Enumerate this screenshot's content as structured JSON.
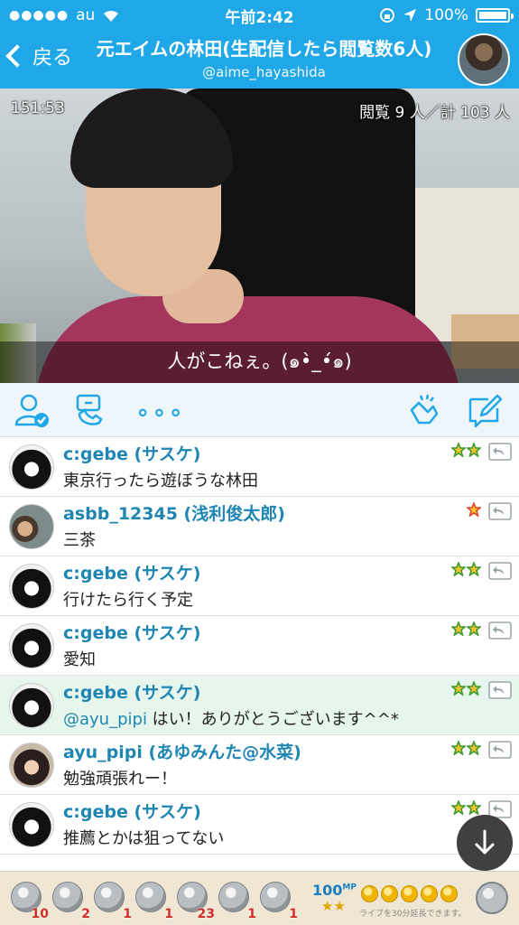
{
  "status_bar": {
    "signal": "●●●●●",
    "carrier": "au",
    "time": "午前2:42",
    "battery": "100%"
  },
  "nav": {
    "back_label": "戻る",
    "title": "元エイムの林田(生配信したら閲覧数6人)",
    "subtitle": "@aime_hayashida"
  },
  "video": {
    "elapsed": "151:53",
    "views": "閲覧 9 人／計 103 人",
    "caption": "人がこねぇ。(๑•̀_•́๑)"
  },
  "toolbar": {
    "more_label": "∘∘∘"
  },
  "comments": [
    {
      "name": "c:gebe (サスケ)",
      "message": "東京行ったら遊ぼうな林田",
      "avatar": "gebe",
      "badge": "green-double",
      "highlight": false
    },
    {
      "name": "asbb_12345 (浅利俊太郎)",
      "message": "三茶",
      "avatar": "asbb",
      "badge": "red-single",
      "highlight": false
    },
    {
      "name": "c:gebe (サスケ)",
      "message": "行けたら行く予定",
      "avatar": "gebe",
      "badge": "green-double",
      "highlight": false
    },
    {
      "name": "c:gebe (サスケ)",
      "message": "愛知",
      "avatar": "gebe",
      "badge": "green-double",
      "highlight": false
    },
    {
      "name": "c:gebe (サスケ)",
      "mention": "@ayu_pipi",
      "message": " はい！ありがとうございます^^*",
      "avatar": "gebe",
      "badge": "green-double",
      "highlight": true
    },
    {
      "name": "ayu_pipi (あゆみんた@水菜)",
      "message": "勉強頑張れー！",
      "avatar": "ayu",
      "badge": "green-double",
      "highlight": false
    },
    {
      "name": "c:gebe (サスケ)",
      "message": "推薦とかは狙ってない",
      "avatar": "gebe",
      "badge": "green-double",
      "highlight": false
    }
  ],
  "gifts": [
    {
      "icon": "coin-icon",
      "count": "10"
    },
    {
      "icon": "cake-icon",
      "count": "2"
    },
    {
      "icon": "clock-icon",
      "count": "1"
    },
    {
      "icon": "scroll-icon",
      "count": "1"
    },
    {
      "icon": "tea-icon",
      "count": "23"
    },
    {
      "icon": "coin-icon",
      "count": "1"
    },
    {
      "icon": "clap-icon",
      "count": "1"
    }
  ],
  "mp": {
    "value": "100",
    "unit": "MP",
    "stars": "★★",
    "note": "ライブを30分延長できます。"
  },
  "colors": {
    "accent": "#1fa7e8",
    "name_text": "#1f86b3",
    "highlight_row": "#e7f6ec",
    "badge_green": "#3f9a2e",
    "badge_gold": "#f2c230",
    "badge_red": "#e0452f"
  }
}
